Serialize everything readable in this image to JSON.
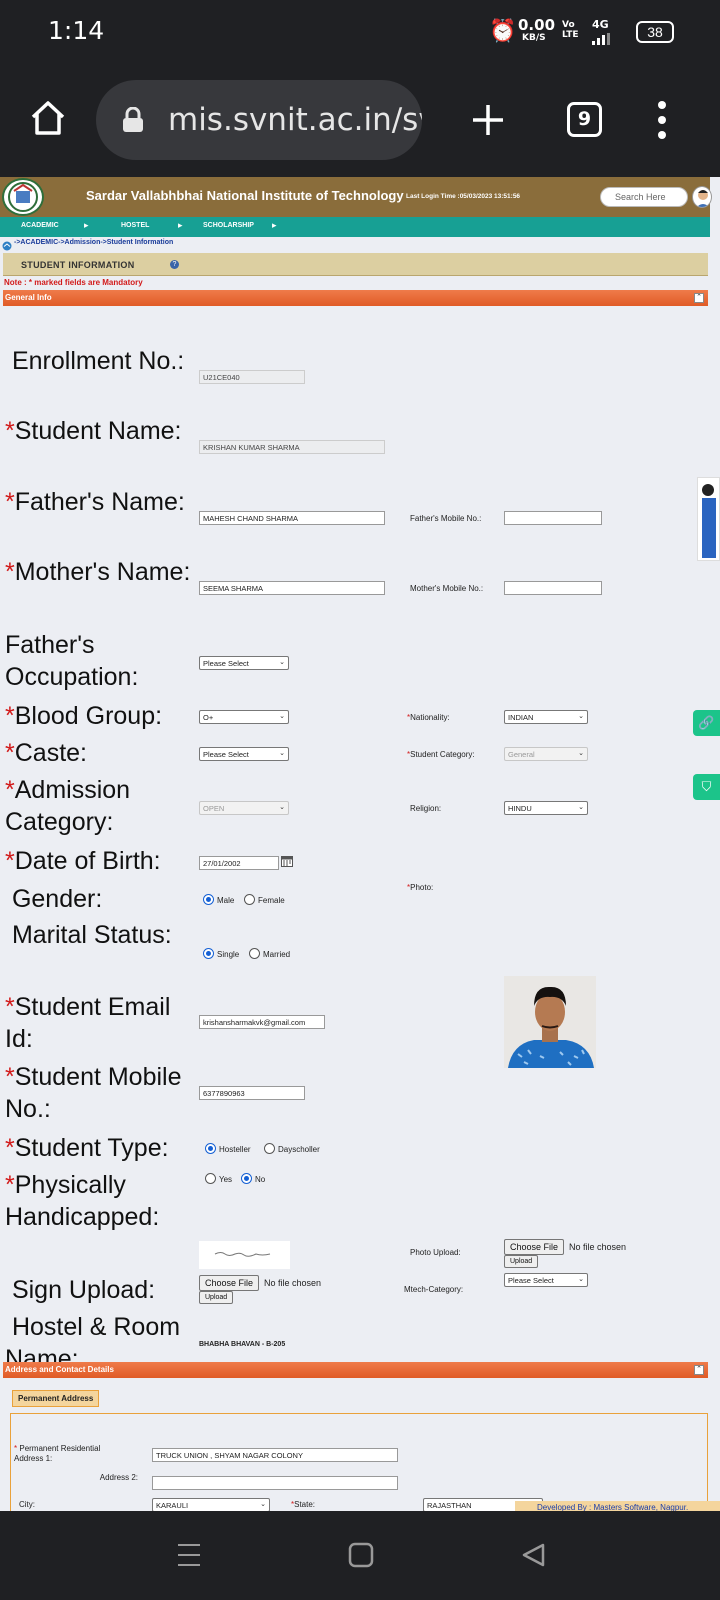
{
  "status_bar": {
    "time": "1:14",
    "net_speed": "0.00",
    "net_unit": "KB/S",
    "volte": "Vo LTE",
    "network": "4G",
    "battery": "38"
  },
  "browser": {
    "url": "mis.svnit.ac.in/sv",
    "tab_count": "9"
  },
  "header": {
    "institute": "Sardar Vallabhbhai National Institute of Technology",
    "last_login": "Last Login Time :05/03/2023 13:51:56",
    "search_placeholder": "Search Here"
  },
  "nav": {
    "items": [
      "ACADEMIC",
      "HOSTEL",
      "SCHOLARSHIP"
    ]
  },
  "breadcrumb": "->ACADEMIC->Admission->Student Information",
  "page_title": "STUDENT INFORMATION",
  "note": "Note : * marked fields are Mandatory",
  "general_info": {
    "section_title": "General Info",
    "enrollment_label": "Enrollment No.:",
    "enrollment_value": "U21CE040",
    "student_name_label": "Student Name:",
    "student_name_value": "KRISHAN KUMAR SHARMA",
    "father_name_label": "Father's Name:",
    "father_name_value": "MAHESH CHAND SHARMA",
    "father_mobile_label": "Father's Mobile No.:",
    "father_mobile_value": "",
    "mother_name_label": "Mother's Name:",
    "mother_name_value": "SEEMA SHARMA",
    "mother_mobile_label": "Mother's Mobile No.:",
    "mother_mobile_value": "",
    "father_occupation_label": "Father's Occupation:",
    "father_occupation_value": "Please Select",
    "blood_group_label": "Blood Group:",
    "blood_group_value": "O+",
    "nationality_label": "Nationality:",
    "nationality_value": "INDIAN",
    "caste_label": "Caste:",
    "caste_value": "Please Select",
    "student_category_label": "Student Category:",
    "student_category_value": "General",
    "admission_category_label": "Admission Category:",
    "admission_category_value": "OPEN",
    "religion_label": "Religion:",
    "religion_value": "HINDU",
    "dob_label": "Date of Birth:",
    "dob_value": "27/01/2002",
    "photo_label": "Photo:",
    "gender_label": "Gender:",
    "gender_options": [
      "Male",
      "Female"
    ],
    "gender_selected": "Male",
    "marital_label": "Marital Status:",
    "marital_options": [
      "Single",
      "Married"
    ],
    "marital_selected": "Single",
    "email_label": "Student Email Id:",
    "email_value": "krishansharmakvk@gmail.com",
    "mobile_label": "Student Mobile No.:",
    "mobile_value": "6377890963",
    "student_type_label": "Student Type:",
    "student_type_options": [
      "Hosteller",
      "Dayscholler"
    ],
    "student_type_selected": "Hosteller",
    "handicapped_label": "Physically Handicapped:",
    "handicapped_options": [
      "Yes",
      "No"
    ],
    "handicapped_selected": "No",
    "photo_upload_label": "Photo Upload:",
    "choose_file": "Choose File",
    "no_file": "No file chosen",
    "upload": "Upload",
    "sign_upload_label": "Sign Upload:",
    "mtech_label": "Mtech-Category:",
    "mtech_value": "Please Select",
    "hostel_label": "Hostel & Room Name:",
    "hostel_value": "BHABHA BHAVAN - B-205"
  },
  "address": {
    "section_title": "Address and Contact Details",
    "permanent_title": "Permanent Address",
    "addr1_label": "Permanent Residential Address 1:",
    "addr1_value": "TRUCK UNION , SHYAM NAGAR COLONY",
    "addr2_label": "Address 2:",
    "addr2_value": "",
    "city_label": "City:",
    "city_value": "KARAULI",
    "state_label": "State:",
    "state_value": "RAJASTHAN"
  },
  "developed_by": "Developed By : Masters Software, Nagpur."
}
